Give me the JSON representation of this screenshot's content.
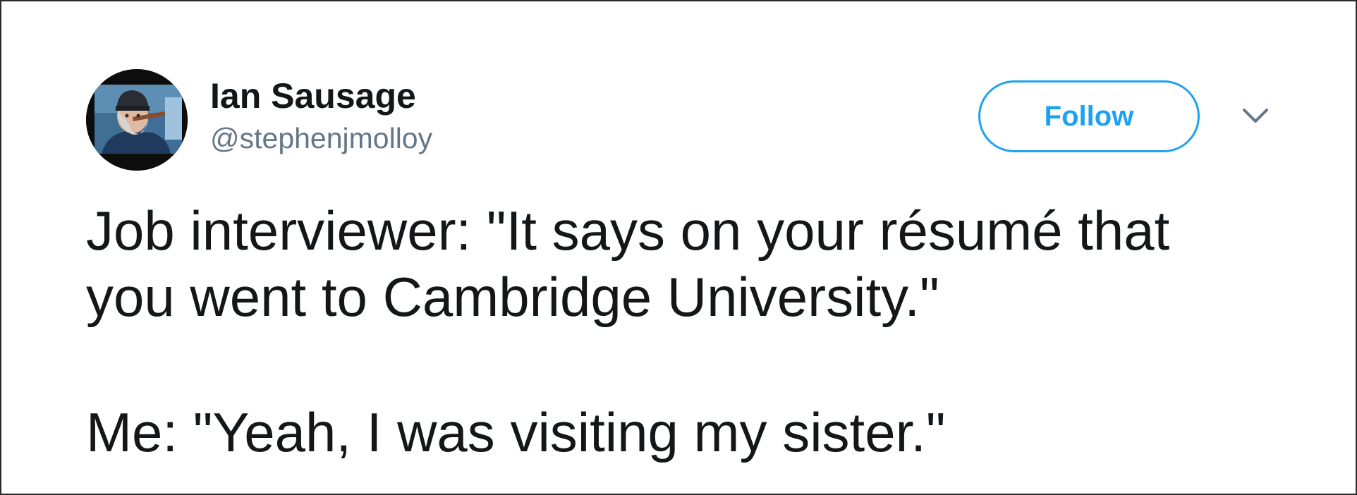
{
  "tweet": {
    "author": {
      "display_name": "Ian Sausage",
      "handle": "@stephenjmolloy",
      "avatar_icon": "profile-photo-icon"
    },
    "follow_label": "Follow",
    "menu_icon": "chevron-down-icon",
    "text_lines": [
      "Job interviewer: \"It says on your résumé that",
      "you went to Cambridge University.\"",
      "Me: \"Yeah, I was visiting my sister.\""
    ]
  },
  "colors": {
    "accent": "#1da1f2",
    "text_primary": "#14171a",
    "text_secondary": "#657786",
    "background": "#ffffff"
  }
}
